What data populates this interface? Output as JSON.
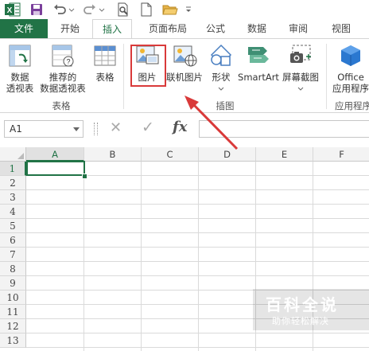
{
  "tabs": [
    {
      "id": "file",
      "label": "文件"
    },
    {
      "id": "home",
      "label": "开始"
    },
    {
      "id": "insert",
      "label": "插入"
    },
    {
      "id": "layout",
      "label": "页面布局"
    },
    {
      "id": "formulas",
      "label": "公式"
    },
    {
      "id": "data",
      "label": "数据"
    },
    {
      "id": "review",
      "label": "审阅"
    },
    {
      "id": "view",
      "label": "视图"
    }
  ],
  "ribbon": {
    "tables_group": {
      "label": "表格",
      "pivot_l1": "数据",
      "pivot_l2": "透视表",
      "rec_pivot_l1": "推荐的",
      "rec_pivot_l2": "数据透视表",
      "table": "表格"
    },
    "illustrations_group": {
      "label": "插图",
      "pictures": "图片",
      "online_pictures": "联机图片",
      "shapes": "形状",
      "smartart": "SmartArt",
      "screenshot": "屏幕截图"
    },
    "apps_group": {
      "label": "应用程序",
      "office_l1": "Office",
      "office_l2": "应用程序"
    }
  },
  "formula_bar": {
    "name_box": "A1",
    "cancel": "✕",
    "enter": "✓",
    "fx": "fx",
    "value": ""
  },
  "sheet": {
    "columns": [
      "A",
      "B",
      "C",
      "D",
      "E",
      "F"
    ],
    "rows": [
      "1",
      "2",
      "3",
      "4",
      "5",
      "6",
      "7",
      "8",
      "9",
      "10",
      "11",
      "12",
      "13"
    ],
    "selected_cell": "A1"
  },
  "watermark": {
    "title": "百科全说",
    "subtitle": "助你轻松解决"
  },
  "colors": {
    "excel_green": "#217346",
    "highlight_red": "#d93a3a"
  }
}
